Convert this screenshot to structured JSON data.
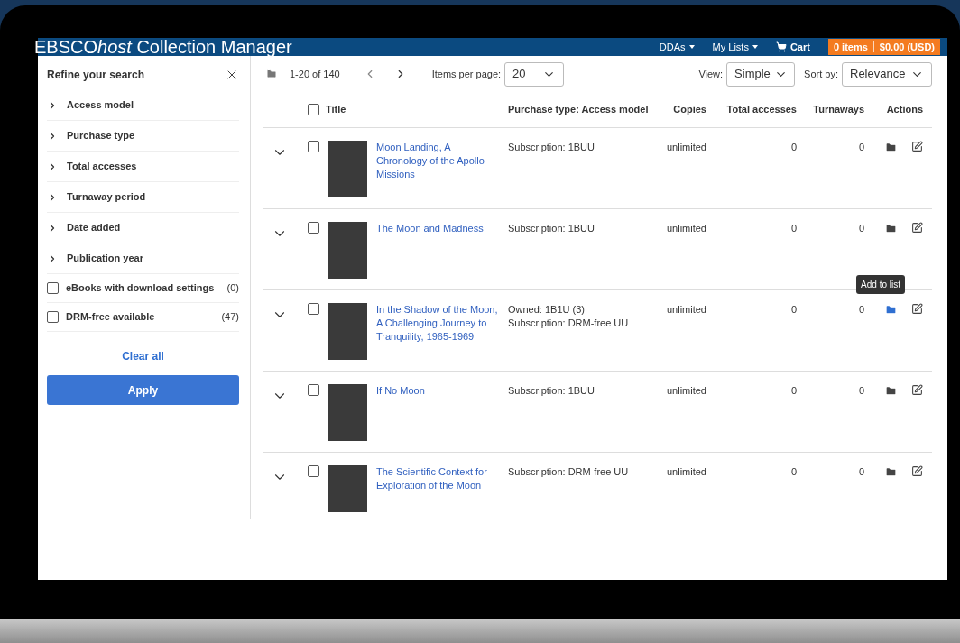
{
  "header": {
    "title": [
      {
        "text": "EBSCO",
        "italic": false
      },
      {
        "text": "host",
        "italic": true
      },
      {
        "text": " Collection Manager",
        "italic": false
      }
    ],
    "menus": [
      "DDAs",
      "My Lists"
    ],
    "cart": {
      "label": "Cart",
      "items": "0 items",
      "total": "$0.00 (USD)"
    }
  },
  "sidebar": {
    "title": "Refine your search",
    "facets": [
      {
        "kind": "expander",
        "label": "Access model",
        "expanded": false
      },
      {
        "kind": "expander",
        "label": "Purchase type",
        "expanded": false
      },
      {
        "kind": "expander",
        "label": "Total accesses",
        "expanded": false
      },
      {
        "kind": "expander",
        "label": "Turnaway period",
        "expanded": false
      },
      {
        "kind": "expander",
        "label": "Date added",
        "expanded": false
      },
      {
        "kind": "expander",
        "label": "Publication year",
        "expanded": false
      },
      {
        "kind": "checkbox",
        "label": "eBooks with download settings",
        "count": "(0)",
        "checked": false
      },
      {
        "kind": "checkbox",
        "label": "DRM-free available",
        "count": "(47)",
        "checked": false
      }
    ],
    "clear": "Clear all",
    "apply": "Apply"
  },
  "toolbar": {
    "range": "1-20 of 140",
    "per_page_label": "Items per page:",
    "per_page": "20",
    "view_label": "View:",
    "view": "Simple",
    "sort_label": "Sort by:",
    "sort": "Relevance"
  },
  "table": {
    "select_all_checked": false,
    "columns": [
      "Title",
      "Purchase type: Access model",
      "Copies",
      "Total accesses",
      "Turnaways",
      "Actions"
    ],
    "rows": [
      {
        "title": "Moon Landing, A Chronology of the Apollo Missions",
        "purchase": [
          "Subscription: 1BUU"
        ],
        "copies": "unlimited",
        "total_accesses": "0",
        "turnaways": "0",
        "checked": false,
        "expanded": false,
        "highlighted": false
      },
      {
        "title": "The Moon and Madness",
        "purchase": [
          "Subscription: 1BUU"
        ],
        "copies": "unlimited",
        "total_accesses": "0",
        "turnaways": "0",
        "checked": false,
        "expanded": false,
        "highlighted": false
      },
      {
        "title": "In the Shadow of the Moon, A Challenging Journey to Tranquility, 1965-1969",
        "purchase": [
          "Owned: 1B1U (3)",
          "Subscription: DRM-free UU"
        ],
        "copies": "unlimited",
        "total_accesses": "0",
        "turnaways": "0",
        "checked": false,
        "expanded": false,
        "highlighted": true,
        "tooltip": "Add to list"
      },
      {
        "title": "If No Moon",
        "purchase": [
          "Subscription: 1BUU"
        ],
        "copies": "unlimited",
        "total_accesses": "0",
        "turnaways": "0",
        "checked": false,
        "expanded": false,
        "highlighted": false
      },
      {
        "title": "The Scientific Context for Exploration of the Moon",
        "purchase": [
          "Subscription: DRM-free UU"
        ],
        "copies": "unlimited",
        "total_accesses": "0",
        "turnaways": "0",
        "checked": false,
        "expanded": false,
        "highlighted": false
      }
    ]
  }
}
